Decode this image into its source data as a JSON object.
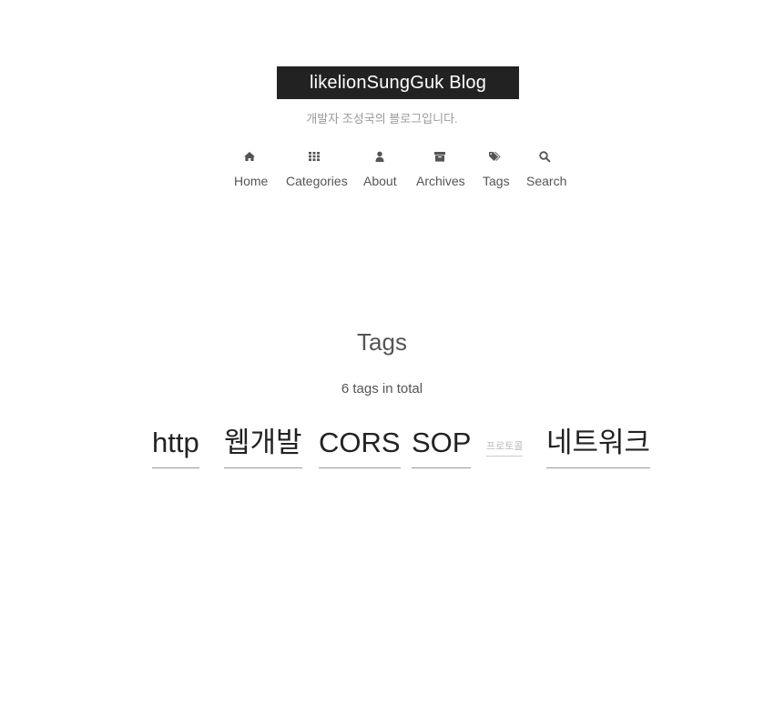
{
  "site": {
    "title": "likelionSungGuk Blog",
    "subtitle": "개발자 조성국의 블로그입니다."
  },
  "menu": {
    "items": [
      {
        "label": "Home",
        "icon": "home-icon"
      },
      {
        "label": "Categories",
        "icon": "th-icon"
      },
      {
        "label": "About",
        "icon": "user-icon"
      },
      {
        "label": "Archives",
        "icon": "archive-icon"
      },
      {
        "label": "Tags",
        "icon": "tags-icon"
      },
      {
        "label": "Search",
        "icon": "search-icon"
      }
    ]
  },
  "tags_page": {
    "title": "Tags",
    "count_text": "6 tags in total",
    "tags": [
      {
        "label": "http"
      },
      {
        "label": "웹개발"
      },
      {
        "label": "CORS"
      },
      {
        "label": "SOP"
      },
      {
        "label": "프로토콜"
      },
      {
        "label": "네트워크"
      }
    ]
  },
  "colors": {
    "brand_bg": "#222222",
    "brand_fg": "#ffffff",
    "text": "#555555",
    "tag_text": "#222222",
    "muted": "#999999"
  }
}
